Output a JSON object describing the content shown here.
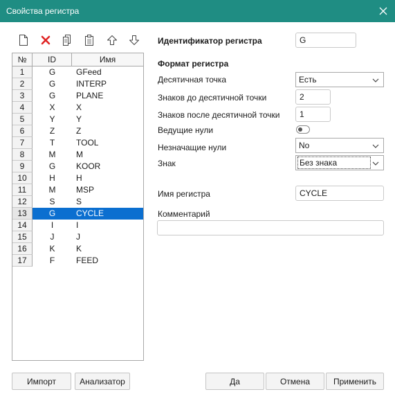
{
  "window": {
    "title": "Свойства регистра"
  },
  "toolbar": {
    "icons": [
      "new-file-icon",
      "delete-icon",
      "copy-icon",
      "paste-icon",
      "move-up-icon",
      "move-down-icon"
    ],
    "delete_color": "#e02424"
  },
  "table": {
    "headers": {
      "num": "№",
      "id": "ID",
      "name": "Имя"
    },
    "rows": [
      {
        "num": "1",
        "id": "G",
        "name": "GFeed"
      },
      {
        "num": "2",
        "id": "G",
        "name": "INTERP"
      },
      {
        "num": "3",
        "id": "G",
        "name": "PLANE"
      },
      {
        "num": "4",
        "id": "X",
        "name": "X"
      },
      {
        "num": "5",
        "id": "Y",
        "name": "Y"
      },
      {
        "num": "6",
        "id": "Z",
        "name": "Z"
      },
      {
        "num": "7",
        "id": "T",
        "name": "TOOL"
      },
      {
        "num": "8",
        "id": "M",
        "name": "M"
      },
      {
        "num": "9",
        "id": "G",
        "name": "KOOR"
      },
      {
        "num": "10",
        "id": "H",
        "name": "H"
      },
      {
        "num": "11",
        "id": "M",
        "name": "MSP"
      },
      {
        "num": "12",
        "id": "S",
        "name": "S"
      },
      {
        "num": "13",
        "id": "G",
        "name": "CYCLE"
      },
      {
        "num": "14",
        "id": "I",
        "name": "I"
      },
      {
        "num": "15",
        "id": "J",
        "name": "J"
      },
      {
        "num": "16",
        "id": "K",
        "name": "K"
      },
      {
        "num": "17",
        "id": "F",
        "name": "FEED"
      }
    ],
    "selected_index": 12,
    "selection_color": "#0b6fd0"
  },
  "form": {
    "id_label": "Идентификатор регистра",
    "id_value": "G",
    "format_header": "Формат регистра",
    "decimal_point_label": "Десятичная точка",
    "decimal_point_value": "Есть",
    "digits_before_label": "Знаков до десятичной точки",
    "digits_before_value": "2",
    "digits_after_label": "Знаков после десятичной точки",
    "digits_after_value": "1",
    "leading_zeros_label": "Ведущие нули",
    "leading_zeros_on": false,
    "trailing_zeros_label": "Незначащие нули",
    "trailing_zeros_value": "No",
    "sign_label": "Знак",
    "sign_value": "Без знака",
    "name_label": "Имя регистра",
    "name_value": "CYCLE",
    "comment_label": "Комментарий",
    "comment_value": ""
  },
  "buttons": {
    "import": "Импорт",
    "analyzer": "Анализатор",
    "ok": "Да",
    "cancel": "Отмена",
    "apply": "Применить"
  },
  "colors": {
    "titlebar": "#1f8d83"
  }
}
